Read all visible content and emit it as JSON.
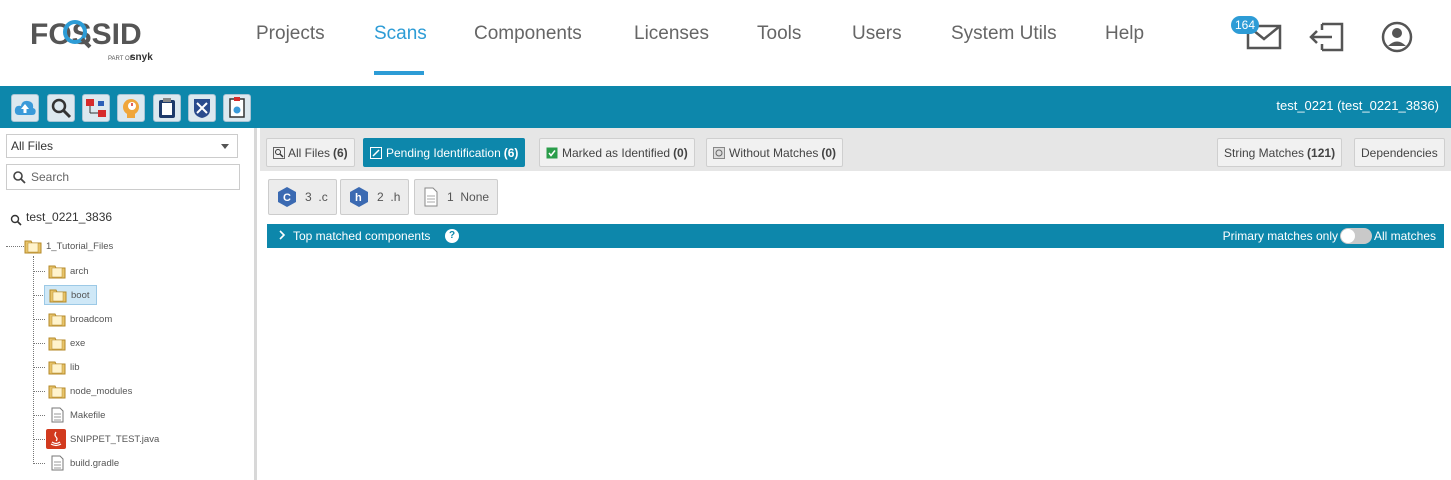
{
  "logo": {
    "brand": "FOSSID",
    "tagline_prefix": "PART OF",
    "tagline_brand": "snyk"
  },
  "nav": {
    "items": [
      {
        "label": "Projects"
      },
      {
        "label": "Scans",
        "active": true
      },
      {
        "label": "Components"
      },
      {
        "label": "Licenses"
      },
      {
        "label": "Tools"
      },
      {
        "label": "Users"
      },
      {
        "label": "System Utils"
      },
      {
        "label": "Help"
      }
    ],
    "mail_count": "164",
    "icons": [
      "mail-icon",
      "logout-icon",
      "user-profile-icon"
    ]
  },
  "toolbar": {
    "buttons": [
      "upload-icon",
      "search-scan-icon",
      "compare-icon",
      "brain-icon",
      "clipboard-icon",
      "vulnerability-icon",
      "report-icon"
    ],
    "scan_title": "test_0221 (test_0221_3836)"
  },
  "sidebar": {
    "filter_value": "All Files",
    "search_placeholder": "Search",
    "tree_root": "test_0221_3836",
    "tree": {
      "root_folder": "1_Tutorial_Files",
      "children": [
        {
          "label": "arch",
          "type": "folder"
        },
        {
          "label": "boot",
          "type": "folder",
          "selected": true
        },
        {
          "label": "broadcom",
          "type": "folder"
        },
        {
          "label": "exe",
          "type": "folder"
        },
        {
          "label": "lib",
          "type": "folder"
        },
        {
          "label": "node_modules",
          "type": "folder"
        },
        {
          "label": "Makefile",
          "type": "file"
        },
        {
          "label": "SNIPPET_TEST.java",
          "type": "java"
        },
        {
          "label": "build.gradle",
          "type": "file"
        }
      ]
    }
  },
  "tabs": {
    "all_files": {
      "label": "All Files",
      "count": "(6)"
    },
    "pending": {
      "label": "Pending Identification",
      "count": "(6)"
    },
    "marked": {
      "label": "Marked as Identified",
      "count": "(0)"
    },
    "without": {
      "label": "Without Matches",
      "count": "(0)"
    },
    "string_matches": {
      "label": "String Matches",
      "count": "(121)"
    },
    "dependencies": {
      "label": "Dependencies"
    }
  },
  "extensions": [
    {
      "count": "3",
      "ext": ".c"
    },
    {
      "count": "2",
      "ext": ".h"
    },
    {
      "count": "1",
      "ext": "None"
    }
  ],
  "top_matched": {
    "title": "Top matched components",
    "help": "?",
    "primary_only": "Primary matches only",
    "all_matches": "All matches"
  },
  "colors": {
    "accent": "#0d87ab",
    "nav_active": "#2d9cd6",
    "badge": "#2d9cd6"
  }
}
